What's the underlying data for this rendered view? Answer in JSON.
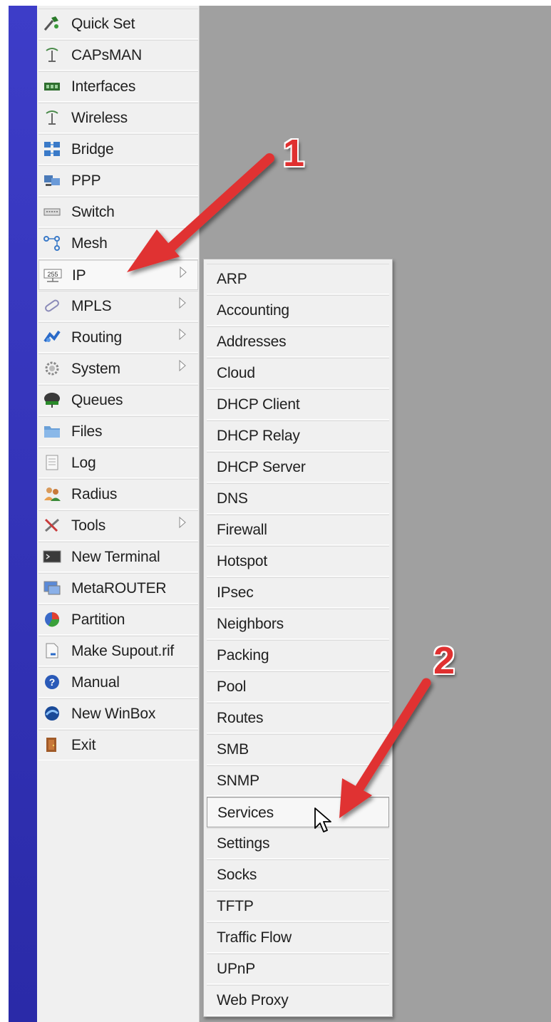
{
  "main_menu": {
    "items": [
      {
        "label": "Quick Set",
        "icon": "quick-set-icon",
        "submenu": false
      },
      {
        "label": "CAPsMAN",
        "icon": "antenna-icon",
        "submenu": false
      },
      {
        "label": "Interfaces",
        "icon": "network-card-icon",
        "submenu": false
      },
      {
        "label": "Wireless",
        "icon": "antenna-icon",
        "submenu": false
      },
      {
        "label": "Bridge",
        "icon": "bridge-icon",
        "submenu": false
      },
      {
        "label": "PPP",
        "icon": "ppp-icon",
        "submenu": false
      },
      {
        "label": "Switch",
        "icon": "switch-icon",
        "submenu": false
      },
      {
        "label": "Mesh",
        "icon": "mesh-icon",
        "submenu": false
      },
      {
        "label": "IP",
        "icon": "ip-icon",
        "submenu": true,
        "selected": true
      },
      {
        "label": "MPLS",
        "icon": "mpls-icon",
        "submenu": true
      },
      {
        "label": "Routing",
        "icon": "routing-icon",
        "submenu": true
      },
      {
        "label": "System",
        "icon": "gear-icon",
        "submenu": true
      },
      {
        "label": "Queues",
        "icon": "queues-icon",
        "submenu": false
      },
      {
        "label": "Files",
        "icon": "folder-icon",
        "submenu": false
      },
      {
        "label": "Log",
        "icon": "log-icon",
        "submenu": false
      },
      {
        "label": "Radius",
        "icon": "users-icon",
        "submenu": false
      },
      {
        "label": "Tools",
        "icon": "tools-icon",
        "submenu": true
      },
      {
        "label": "New Terminal",
        "icon": "terminal-icon",
        "submenu": false
      },
      {
        "label": "MetaROUTER",
        "icon": "metarouter-icon",
        "submenu": false
      },
      {
        "label": "Partition",
        "icon": "pie-icon",
        "submenu": false
      },
      {
        "label": "Make Supout.rif",
        "icon": "file-icon",
        "submenu": false
      },
      {
        "label": "Manual",
        "icon": "help-icon",
        "submenu": false
      },
      {
        "label": "New WinBox",
        "icon": "winbox-icon",
        "submenu": false
      },
      {
        "label": "Exit",
        "icon": "exit-door-icon",
        "submenu": false
      }
    ]
  },
  "ip_submenu": {
    "items": [
      {
        "label": "ARP"
      },
      {
        "label": "Accounting"
      },
      {
        "label": "Addresses"
      },
      {
        "label": "Cloud"
      },
      {
        "label": "DHCP Client"
      },
      {
        "label": "DHCP Relay"
      },
      {
        "label": "DHCP Server"
      },
      {
        "label": "DNS"
      },
      {
        "label": "Firewall"
      },
      {
        "label": "Hotspot"
      },
      {
        "label": "IPsec"
      },
      {
        "label": "Neighbors"
      },
      {
        "label": "Packing"
      },
      {
        "label": "Pool"
      },
      {
        "label": "Routes"
      },
      {
        "label": "SMB"
      },
      {
        "label": "SNMP"
      },
      {
        "label": "Services",
        "hover": true
      },
      {
        "label": "Settings"
      },
      {
        "label": "Socks"
      },
      {
        "label": "TFTP"
      },
      {
        "label": "Traffic Flow"
      },
      {
        "label": "UPnP"
      },
      {
        "label": "Web Proxy"
      }
    ]
  },
  "annotations": {
    "step1": "1",
    "step2": "2",
    "arrow_color": "#e03030"
  }
}
